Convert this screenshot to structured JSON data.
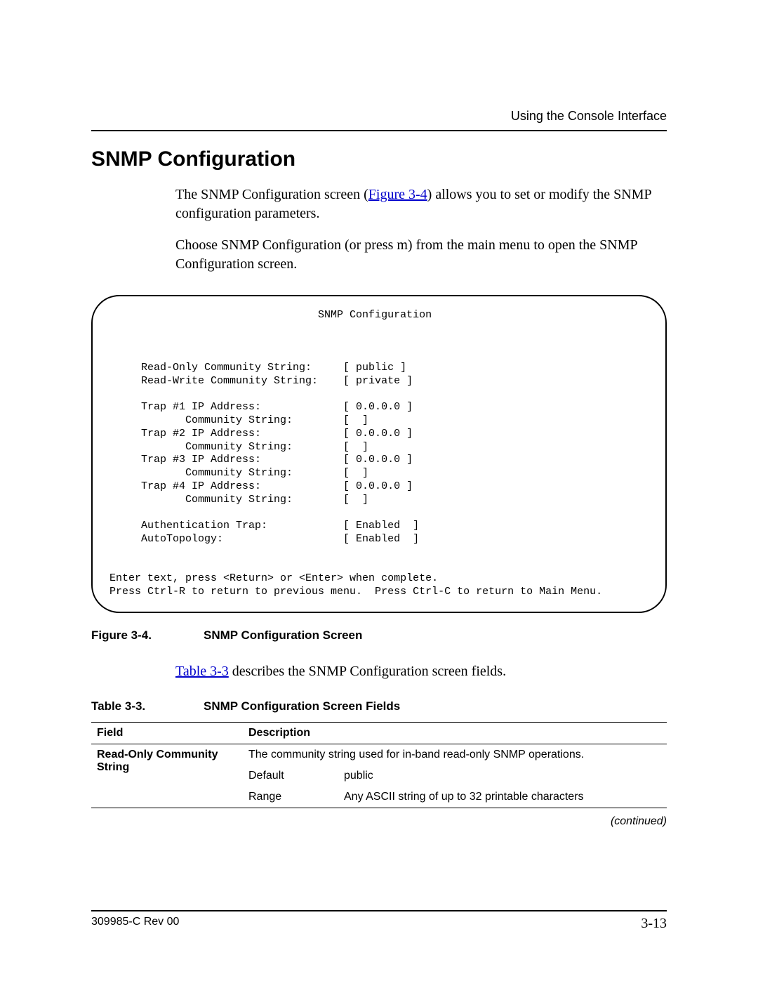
{
  "header": {
    "running_head": "Using the Console Interface"
  },
  "section": {
    "title": "SNMP Configuration",
    "para1a": "The SNMP Configuration screen (",
    "para1_link": "Figure 3-4",
    "para1b": ") allows you to set or modify the SNMP configuration parameters.",
    "para2": "Choose SNMP Configuration (or press m) from the main menu to open the SNMP Configuration screen."
  },
  "console": {
    "title": "SNMP Configuration",
    "rows": [
      {
        "label": "Read-Only Community String:",
        "value": "[ public ]"
      },
      {
        "label": "Read-Write Community String:",
        "value": "[ private ]"
      },
      {
        "label": "",
        "value": ""
      },
      {
        "label": "Trap #1 IP Address:",
        "value": "[ 0.0.0.0 ]"
      },
      {
        "label": "       Community String:",
        "value": "[  ]"
      },
      {
        "label": "Trap #2 IP Address:",
        "value": "[ 0.0.0.0 ]"
      },
      {
        "label": "       Community String:",
        "value": "[  ]"
      },
      {
        "label": "Trap #3 IP Address:",
        "value": "[ 0.0.0.0 ]"
      },
      {
        "label": "       Community String:",
        "value": "[  ]"
      },
      {
        "label": "Trap #4 IP Address:",
        "value": "[ 0.0.0.0 ]"
      },
      {
        "label": "       Community String:",
        "value": "[  ]"
      },
      {
        "label": "",
        "value": ""
      },
      {
        "label": "Authentication Trap:",
        "value": "[ Enabled  ]"
      },
      {
        "label": "AutoTopology:",
        "value": "[ Enabled  ]"
      }
    ],
    "help1": "Enter text, press <Return> or <Enter> when complete.",
    "help2": "Press Ctrl-R to return to previous menu.  Press Ctrl-C to return to Main Menu."
  },
  "figure": {
    "number": "Figure 3-4.",
    "title": "SNMP Configuration Screen"
  },
  "after_figure": {
    "link": "Table 3-3",
    "rest": " describes the SNMP Configuration screen fields."
  },
  "table": {
    "number": "Table 3-3.",
    "title": "SNMP Configuration Screen Fields",
    "head_field": "Field",
    "head_desc": "Description",
    "row1_field": "Read-Only Community String",
    "row1_desc": "The community string used for in-band read-only SNMP operations.",
    "row1_default_label": "Default",
    "row1_default_value": "public",
    "row1_range_label": "Range",
    "row1_range_value": "Any ASCII string of up to 32 printable characters",
    "continued": "(continued)"
  },
  "footer": {
    "docnum": "309985-C Rev 00",
    "pagenum": "3-13"
  }
}
